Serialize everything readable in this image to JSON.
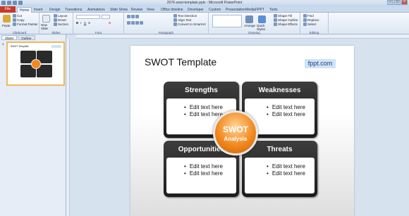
{
  "window": {
    "title": "2076-swot-template.pptx - Microsoft PowerPoint"
  },
  "tabs": [
    "File",
    "Home",
    "Insert",
    "Design",
    "Transitions",
    "Animations",
    "Slide Show",
    "Review",
    "View",
    "Office timeline",
    "Developer",
    "Custom",
    "PresentationMedia",
    "FPPT",
    "Tools"
  ],
  "ribbon": {
    "clipboard": {
      "paste": "Paste",
      "cut": "Cut",
      "copy": "Copy",
      "format_painter": "Format Painter",
      "label": "Clipboard"
    },
    "slides": {
      "new_slide": "New Slide",
      "layout": "Layout",
      "reset": "Reset",
      "section": "Section",
      "label": "Slides"
    },
    "font": {
      "label": "Font"
    },
    "paragraph": {
      "text_direction": "Text Direction",
      "align_text": "Align Text",
      "convert": "Convert to SmartArt",
      "label": "Paragraph"
    },
    "drawing": {
      "arrange": "Arrange",
      "quick_styles": "Quick Styles",
      "shape_fill": "Shape Fill",
      "shape_outline": "Shape Outline",
      "shape_effects": "Shape Effects",
      "label": "Drawing"
    },
    "editing": {
      "find": "Find",
      "replace": "Replace",
      "select": "Select",
      "label": "Editing"
    }
  },
  "left_pane": {
    "tabs": [
      "Slides",
      "Outline"
    ],
    "slide_number": "1"
  },
  "slide": {
    "title": "SWOT Template",
    "badge": "fppt.com",
    "center": {
      "line1": "SWOT",
      "line2": "Analysis"
    },
    "cards": [
      {
        "title": "Strengths",
        "items": [
          "Edit text here",
          "Edit text here"
        ]
      },
      {
        "title": "Weaknesses",
        "items": [
          "Edit text here",
          "Edit text here"
        ]
      },
      {
        "title": "Opportunities",
        "items": [
          "Edit text here",
          "Edit text here"
        ]
      },
      {
        "title": "Threats",
        "items": [
          "Edit text here",
          "Edit text here"
        ]
      }
    ]
  },
  "colors": {
    "file_tab": "#c63a2a",
    "accent": "#f2891e",
    "card": "#2a2a2a"
  }
}
